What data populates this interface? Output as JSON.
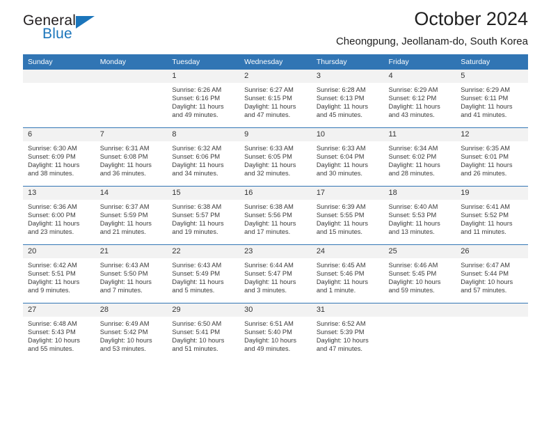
{
  "brand": {
    "name_top": "General",
    "name_bottom": "Blue",
    "accent_color": "#1b75bb"
  },
  "header": {
    "title": "October 2024",
    "subtitle": "Cheongpung, Jeollanam-do, South Korea"
  },
  "calendar": {
    "header_bg": "#3175b4",
    "daynum_bg": "#f2f2f2",
    "weekdays": [
      "Sunday",
      "Monday",
      "Tuesday",
      "Wednesday",
      "Thursday",
      "Friday",
      "Saturday"
    ],
    "weeks": [
      [
        {
          "day": "",
          "sunrise": "",
          "sunset": "",
          "daylight_line1": "",
          "daylight_line2": "",
          "empty": true
        },
        {
          "day": "",
          "sunrise": "",
          "sunset": "",
          "daylight_line1": "",
          "daylight_line2": "",
          "empty": true
        },
        {
          "day": "1",
          "sunrise": "Sunrise: 6:26 AM",
          "sunset": "Sunset: 6:16 PM",
          "daylight_line1": "Daylight: 11 hours",
          "daylight_line2": "and 49 minutes."
        },
        {
          "day": "2",
          "sunrise": "Sunrise: 6:27 AM",
          "sunset": "Sunset: 6:15 PM",
          "daylight_line1": "Daylight: 11 hours",
          "daylight_line2": "and 47 minutes."
        },
        {
          "day": "3",
          "sunrise": "Sunrise: 6:28 AM",
          "sunset": "Sunset: 6:13 PM",
          "daylight_line1": "Daylight: 11 hours",
          "daylight_line2": "and 45 minutes."
        },
        {
          "day": "4",
          "sunrise": "Sunrise: 6:29 AM",
          "sunset": "Sunset: 6:12 PM",
          "daylight_line1": "Daylight: 11 hours",
          "daylight_line2": "and 43 minutes."
        },
        {
          "day": "5",
          "sunrise": "Sunrise: 6:29 AM",
          "sunset": "Sunset: 6:11 PM",
          "daylight_line1": "Daylight: 11 hours",
          "daylight_line2": "and 41 minutes."
        }
      ],
      [
        {
          "day": "6",
          "sunrise": "Sunrise: 6:30 AM",
          "sunset": "Sunset: 6:09 PM",
          "daylight_line1": "Daylight: 11 hours",
          "daylight_line2": "and 38 minutes."
        },
        {
          "day": "7",
          "sunrise": "Sunrise: 6:31 AM",
          "sunset": "Sunset: 6:08 PM",
          "daylight_line1": "Daylight: 11 hours",
          "daylight_line2": "and 36 minutes."
        },
        {
          "day": "8",
          "sunrise": "Sunrise: 6:32 AM",
          "sunset": "Sunset: 6:06 PM",
          "daylight_line1": "Daylight: 11 hours",
          "daylight_line2": "and 34 minutes."
        },
        {
          "day": "9",
          "sunrise": "Sunrise: 6:33 AM",
          "sunset": "Sunset: 6:05 PM",
          "daylight_line1": "Daylight: 11 hours",
          "daylight_line2": "and 32 minutes."
        },
        {
          "day": "10",
          "sunrise": "Sunrise: 6:33 AM",
          "sunset": "Sunset: 6:04 PM",
          "daylight_line1": "Daylight: 11 hours",
          "daylight_line2": "and 30 minutes."
        },
        {
          "day": "11",
          "sunrise": "Sunrise: 6:34 AM",
          "sunset": "Sunset: 6:02 PM",
          "daylight_line1": "Daylight: 11 hours",
          "daylight_line2": "and 28 minutes."
        },
        {
          "day": "12",
          "sunrise": "Sunrise: 6:35 AM",
          "sunset": "Sunset: 6:01 PM",
          "daylight_line1": "Daylight: 11 hours",
          "daylight_line2": "and 26 minutes."
        }
      ],
      [
        {
          "day": "13",
          "sunrise": "Sunrise: 6:36 AM",
          "sunset": "Sunset: 6:00 PM",
          "daylight_line1": "Daylight: 11 hours",
          "daylight_line2": "and 23 minutes."
        },
        {
          "day": "14",
          "sunrise": "Sunrise: 6:37 AM",
          "sunset": "Sunset: 5:59 PM",
          "daylight_line1": "Daylight: 11 hours",
          "daylight_line2": "and 21 minutes."
        },
        {
          "day": "15",
          "sunrise": "Sunrise: 6:38 AM",
          "sunset": "Sunset: 5:57 PM",
          "daylight_line1": "Daylight: 11 hours",
          "daylight_line2": "and 19 minutes."
        },
        {
          "day": "16",
          "sunrise": "Sunrise: 6:38 AM",
          "sunset": "Sunset: 5:56 PM",
          "daylight_line1": "Daylight: 11 hours",
          "daylight_line2": "and 17 minutes."
        },
        {
          "day": "17",
          "sunrise": "Sunrise: 6:39 AM",
          "sunset": "Sunset: 5:55 PM",
          "daylight_line1": "Daylight: 11 hours",
          "daylight_line2": "and 15 minutes."
        },
        {
          "day": "18",
          "sunrise": "Sunrise: 6:40 AM",
          "sunset": "Sunset: 5:53 PM",
          "daylight_line1": "Daylight: 11 hours",
          "daylight_line2": "and 13 minutes."
        },
        {
          "day": "19",
          "sunrise": "Sunrise: 6:41 AM",
          "sunset": "Sunset: 5:52 PM",
          "daylight_line1": "Daylight: 11 hours",
          "daylight_line2": "and 11 minutes."
        }
      ],
      [
        {
          "day": "20",
          "sunrise": "Sunrise: 6:42 AM",
          "sunset": "Sunset: 5:51 PM",
          "daylight_line1": "Daylight: 11 hours",
          "daylight_line2": "and 9 minutes."
        },
        {
          "day": "21",
          "sunrise": "Sunrise: 6:43 AM",
          "sunset": "Sunset: 5:50 PM",
          "daylight_line1": "Daylight: 11 hours",
          "daylight_line2": "and 7 minutes."
        },
        {
          "day": "22",
          "sunrise": "Sunrise: 6:43 AM",
          "sunset": "Sunset: 5:49 PM",
          "daylight_line1": "Daylight: 11 hours",
          "daylight_line2": "and 5 minutes."
        },
        {
          "day": "23",
          "sunrise": "Sunrise: 6:44 AM",
          "sunset": "Sunset: 5:47 PM",
          "daylight_line1": "Daylight: 11 hours",
          "daylight_line2": "and 3 minutes."
        },
        {
          "day": "24",
          "sunrise": "Sunrise: 6:45 AM",
          "sunset": "Sunset: 5:46 PM",
          "daylight_line1": "Daylight: 11 hours",
          "daylight_line2": "and 1 minute."
        },
        {
          "day": "25",
          "sunrise": "Sunrise: 6:46 AM",
          "sunset": "Sunset: 5:45 PM",
          "daylight_line1": "Daylight: 10 hours",
          "daylight_line2": "and 59 minutes."
        },
        {
          "day": "26",
          "sunrise": "Sunrise: 6:47 AM",
          "sunset": "Sunset: 5:44 PM",
          "daylight_line1": "Daylight: 10 hours",
          "daylight_line2": "and 57 minutes."
        }
      ],
      [
        {
          "day": "27",
          "sunrise": "Sunrise: 6:48 AM",
          "sunset": "Sunset: 5:43 PM",
          "daylight_line1": "Daylight: 10 hours",
          "daylight_line2": "and 55 minutes."
        },
        {
          "day": "28",
          "sunrise": "Sunrise: 6:49 AM",
          "sunset": "Sunset: 5:42 PM",
          "daylight_line1": "Daylight: 10 hours",
          "daylight_line2": "and 53 minutes."
        },
        {
          "day": "29",
          "sunrise": "Sunrise: 6:50 AM",
          "sunset": "Sunset: 5:41 PM",
          "daylight_line1": "Daylight: 10 hours",
          "daylight_line2": "and 51 minutes."
        },
        {
          "day": "30",
          "sunrise": "Sunrise: 6:51 AM",
          "sunset": "Sunset: 5:40 PM",
          "daylight_line1": "Daylight: 10 hours",
          "daylight_line2": "and 49 minutes."
        },
        {
          "day": "31",
          "sunrise": "Sunrise: 6:52 AM",
          "sunset": "Sunset: 5:39 PM",
          "daylight_line1": "Daylight: 10 hours",
          "daylight_line2": "and 47 minutes."
        },
        {
          "day": "",
          "sunrise": "",
          "sunset": "",
          "daylight_line1": "",
          "daylight_line2": "",
          "empty": true
        },
        {
          "day": "",
          "sunrise": "",
          "sunset": "",
          "daylight_line1": "",
          "daylight_line2": "",
          "empty": true
        }
      ]
    ]
  }
}
